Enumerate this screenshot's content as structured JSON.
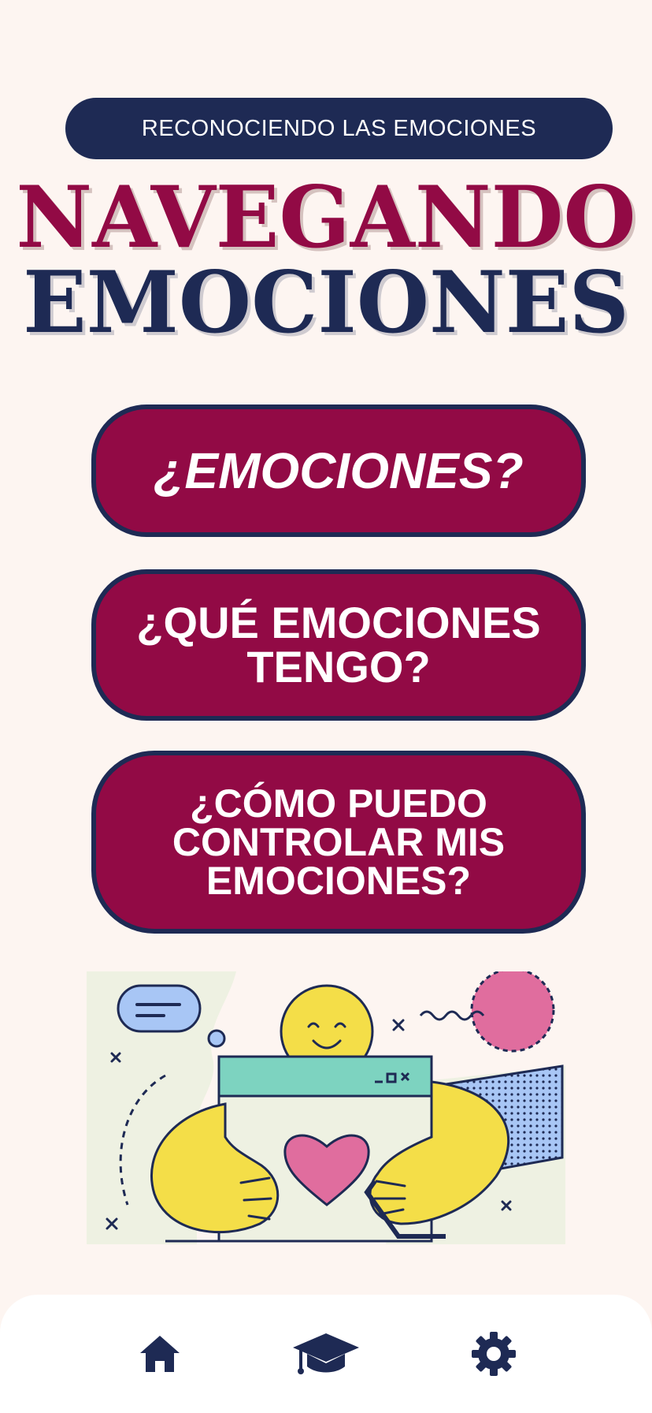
{
  "header": {
    "subtitle": "RECONOCIENDO LAS EMOCIONES",
    "title_line1": "NAVEGANDO",
    "title_line2": "EMOCIONES"
  },
  "menu": [
    {
      "label": "¿EMOCIONES?"
    },
    {
      "label": "¿QUÉ EMOCIONES TENGO?"
    },
    {
      "label": "¿CÓMO PUEDO CONTROLAR MIS EMOCIONES?"
    }
  ],
  "bottom_nav": {
    "items": [
      {
        "icon": "home-icon"
      },
      {
        "icon": "graduation-cap-icon"
      },
      {
        "icon": "gear-icon"
      }
    ]
  },
  "colors": {
    "background": "#fdf5f1",
    "navy": "#1e2a54",
    "crimson": "#920a45",
    "yellow": "#f4de48",
    "teal": "#7dd3c0",
    "pink": "#e06d9e",
    "blue": "#a8c6f5"
  }
}
